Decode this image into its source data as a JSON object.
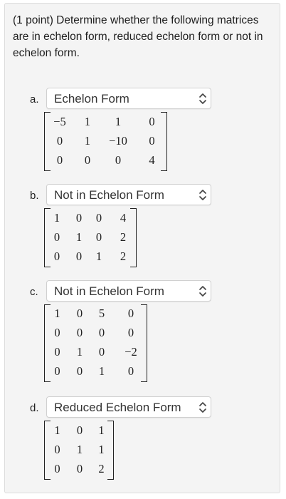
{
  "question": "(1 point) Determine whether the following matrices are in echelon form, reduced echelon form or not in echelon form.",
  "parts": [
    {
      "label": "a.",
      "answer": "Echelon Form",
      "matrix": [
        [
          "−5",
          "1",
          "1",
          "0"
        ],
        [
          "0",
          "1",
          "−10",
          "0"
        ],
        [
          "0",
          "0",
          "0",
          "4"
        ]
      ]
    },
    {
      "label": "b.",
      "answer": "Not in Echelon Form",
      "matrix": [
        [
          "1",
          "0",
          "0",
          "4"
        ],
        [
          "0",
          "1",
          "0",
          "2"
        ],
        [
          "0",
          "0",
          "1",
          "2"
        ]
      ]
    },
    {
      "label": "c.",
      "answer": "Not in Echelon Form",
      "matrix": [
        [
          "1",
          "0",
          "5",
          "0"
        ],
        [
          "0",
          "0",
          "0",
          "0"
        ],
        [
          "0",
          "1",
          "0",
          "−2"
        ],
        [
          "0",
          "0",
          "1",
          "0"
        ]
      ]
    },
    {
      "label": "d.",
      "answer": "Reduced Echelon Form",
      "matrix": [
        [
          "1",
          "0",
          "1"
        ],
        [
          "0",
          "1",
          "1"
        ],
        [
          "0",
          "0",
          "2"
        ]
      ]
    }
  ],
  "icons": {
    "select_arrow": "chevron-up-down-icon"
  }
}
